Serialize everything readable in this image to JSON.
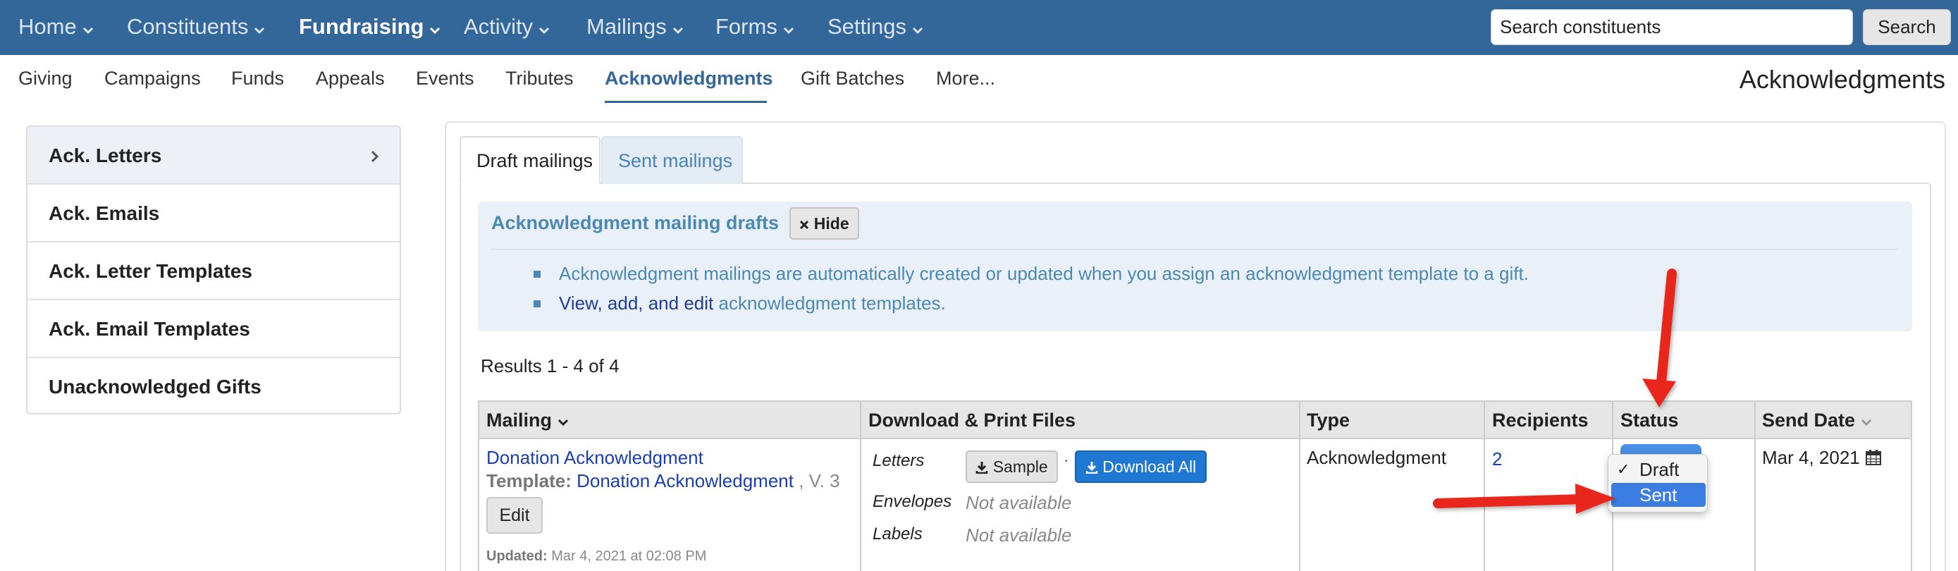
{
  "topnav": {
    "items": [
      {
        "label": "Home",
        "active": false
      },
      {
        "label": "Constituents",
        "active": false
      },
      {
        "label": "Fundraising",
        "active": true
      },
      {
        "label": "Activity",
        "active": false
      },
      {
        "label": "Mailings",
        "active": false
      },
      {
        "label": "Forms",
        "active": false
      },
      {
        "label": "Settings",
        "active": false
      }
    ],
    "search_value": "Search constituents",
    "search_button": "Search"
  },
  "subnav": {
    "items": [
      "Giving",
      "Campaigns",
      "Funds",
      "Appeals",
      "Events",
      "Tributes",
      "Acknowledgments",
      "Gift Batches",
      "More..."
    ],
    "active": "Acknowledgments",
    "page_heading": "Acknowledgments"
  },
  "sidebar": {
    "items": [
      {
        "label": "Ack. Letters",
        "active": true
      },
      {
        "label": "Ack. Emails",
        "active": false
      },
      {
        "label": "Ack. Letter Templates",
        "active": false
      },
      {
        "label": "Ack. Email Templates",
        "active": false
      },
      {
        "label": "Unacknowledged Gifts",
        "active": false
      }
    ]
  },
  "tabs": [
    "Draft mailings",
    "Sent mailings"
  ],
  "info": {
    "title": "Acknowledgment mailing drafts",
    "hide_label": "Hide",
    "line1": "Acknowledgment mailings are automatically created or updated when you assign an acknowledgment template to a gift.",
    "line2_link": "View, add, and edit",
    "line2_rest": "acknowledgment templates."
  },
  "results_text": "Results 1 - 4 of 4",
  "table": {
    "headers": [
      "Mailing",
      "Download & Print Files",
      "Type",
      "Recipients",
      "Status",
      "Send Date"
    ],
    "row": {
      "mailing_name": "Donation Acknowledgment",
      "template_label": "Template:",
      "template_name": "Donation Acknowledgment",
      "template_version": ", V. 3",
      "edit_label": "Edit",
      "updated_label": "Updated:",
      "updated_value": "Mar 4, 2021 at 02:08 PM",
      "files": {
        "letters_label": "Letters",
        "sample_label": "Sample",
        "separator": "·",
        "download_all_label": "Download All",
        "envelopes_label": "Envelopes",
        "envelopes_value": "Not available",
        "labels_label": "Labels",
        "labels_value": "Not available"
      },
      "type": "Acknowledgment",
      "recipients": "2",
      "status_options": [
        "Draft",
        "Sent"
      ],
      "status_selected": "Draft",
      "status_highlighted": "Sent",
      "send_date": "Mar 4, 2021"
    }
  },
  "colors": {
    "nav_bg": "#336699",
    "accent": "#336699",
    "link": "#1a3fb0",
    "info_bg": "#eaf0f7",
    "primary_button": "#1f78d1",
    "annotation_arrow": "#e8271d"
  },
  "icons": [
    "chevron-down-icon",
    "chevron-right-icon",
    "close-icon",
    "download-icon",
    "calendar-icon",
    "check-icon",
    "sort-caret-icon"
  ]
}
